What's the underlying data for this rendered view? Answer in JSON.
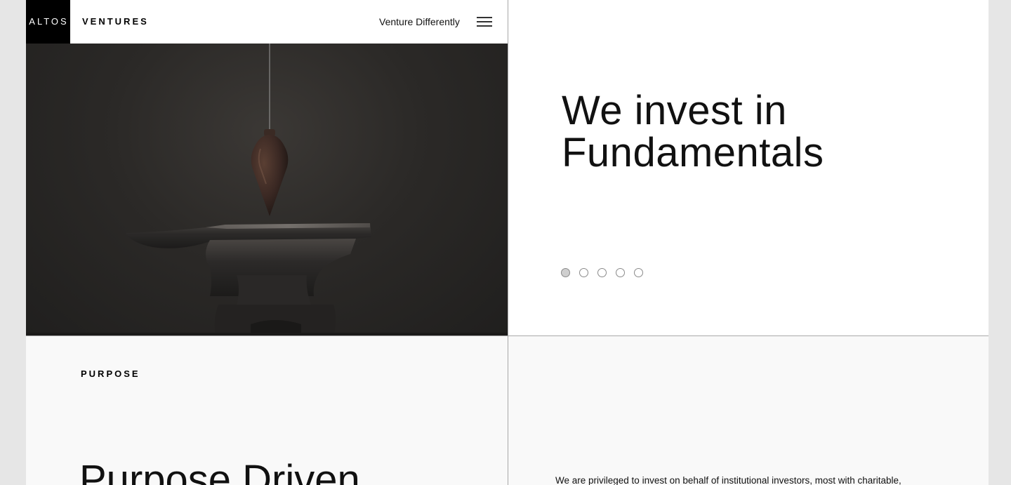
{
  "header": {
    "logo_box": "ALTOS",
    "logo_word": "VENTURES",
    "tagline": "Venture Differently",
    "menu_icon": "hamburger-menu-icon"
  },
  "hero": {
    "image_subject": "plumb bob hanging over anvil",
    "title_lines": [
      "We invest in",
      "Fundamentals"
    ],
    "slides": {
      "count": 5,
      "active_index": 0
    }
  },
  "purpose": {
    "label": "PURPOSE",
    "heading": "Purpose Driven",
    "body": "We are privileged to invest on behalf of institutional investors, most with charitable,"
  },
  "colors": {
    "logo_background": "#000000",
    "hero_image_dark": "#2b2927",
    "panel_background": "#f9f9f9",
    "divider": "#a8a8a8",
    "dot_active": "#cfcfcf"
  }
}
